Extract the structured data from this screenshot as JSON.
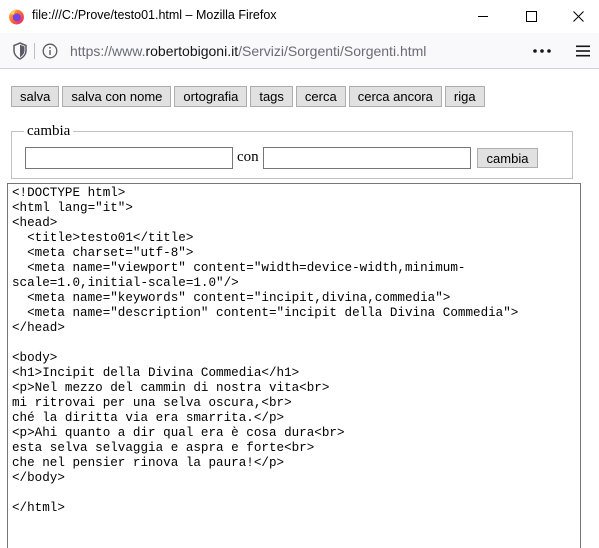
{
  "window": {
    "title": "file:///C:/Prove/testo01.html – Mozilla Firefox"
  },
  "urlbar": {
    "prefix": "https://www.",
    "host": "robertobigoni.it",
    "path": "/Servizi/Sorgenti/Sorgenti.html"
  },
  "toolbar": {
    "buttons": [
      "salva",
      "salva con nome",
      "ortografia",
      "tags",
      "cerca",
      "cerca ancora",
      "riga"
    ]
  },
  "replace": {
    "legend": "cambia",
    "find_value": "",
    "with_label": "con",
    "replace_value": "",
    "button": "cambia"
  },
  "editor": {
    "lines": [
      "<!DOCTYPE html>",
      "<html lang=\"it\">",
      "<head>",
      "  <title>testo01</title>",
      "  <meta charset=\"utf-8\">",
      "  <meta name=\"viewport\" content=\"width=device-width,minimum-",
      "scale=1.0,initial-scale=1.0\"/>",
      "  <meta name=\"keywords\" content=\"incipit,divina,commedia\">",
      "  <meta name=\"description\" content=\"incipit della Divina Commedia\">",
      "</head>",
      "",
      "<body>",
      "<h1>Incipit della Divina Commedia</h1>",
      "<p>Nel mezzo del cammin di nostra vita<br>",
      "mi ritrovai per una selva oscura,<br>",
      "ché la diritta via era smarrita.</p>",
      "<p>Ahi quanto a dir qual era è cosa dura<br>",
      "esta selva selvaggia e aspra e forte<br>",
      "che nel pensier rinova la paura!</p>",
      "</body>",
      "",
      "</html>"
    ]
  }
}
